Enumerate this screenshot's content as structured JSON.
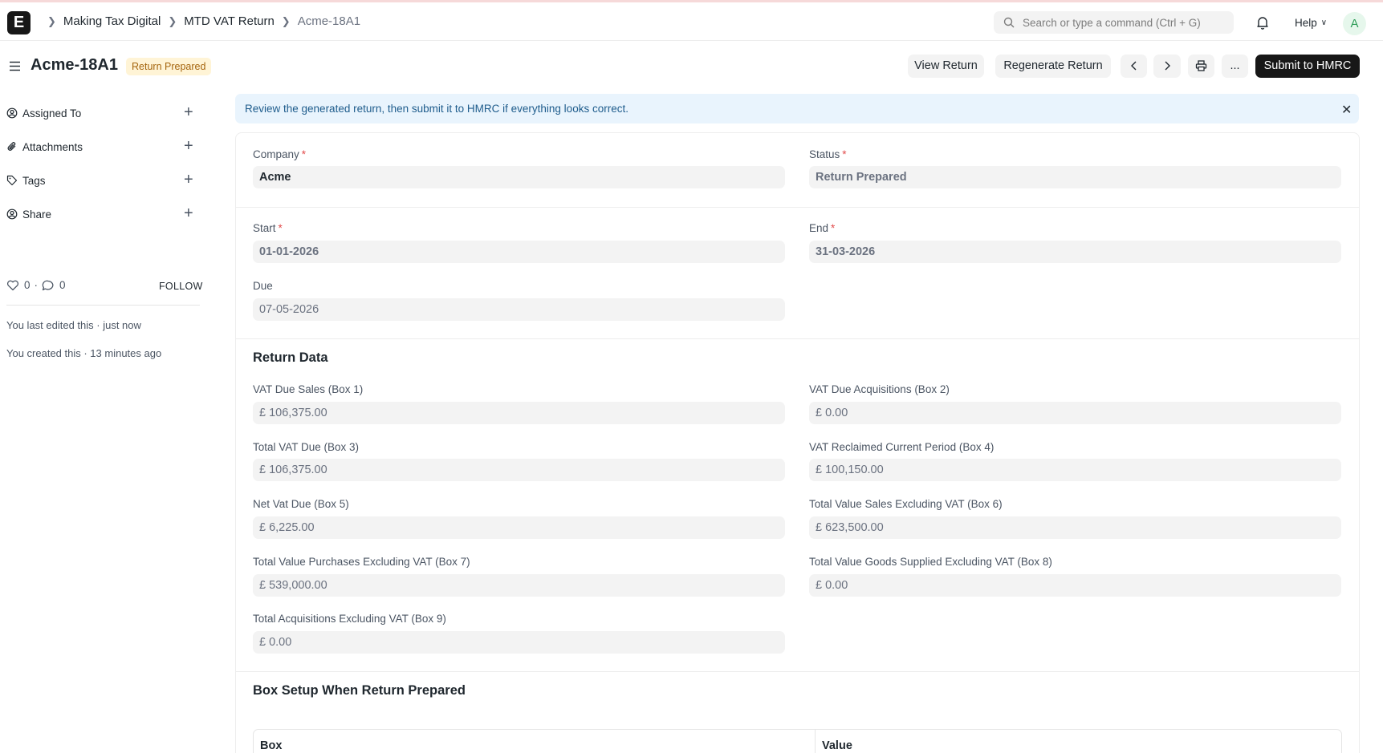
{
  "navbar": {
    "logo_letter": "E",
    "breadcrumbs": [
      "Making Tax Digital",
      "MTD VAT Return",
      "Acme-18A1"
    ],
    "search_placeholder": "Search or type a command (Ctrl + G)",
    "help_label": "Help",
    "avatar_initial": "A"
  },
  "header": {
    "title": "Acme-18A1",
    "status": "Return Prepared",
    "buttons": {
      "view": "View Return",
      "regenerate": "Regenerate Return",
      "more": "...",
      "submit": "Submit to HMRC"
    }
  },
  "sidebar": {
    "items": [
      {
        "label": "Assigned To",
        "icon": "assign-icon"
      },
      {
        "label": "Attachments",
        "icon": "paperclip-icon"
      },
      {
        "label": "Tags",
        "icon": "tag-icon"
      },
      {
        "label": "Share",
        "icon": "share-icon"
      }
    ],
    "likes": "0",
    "comments": "0",
    "follow": "FOLLOW",
    "activity": [
      "You last edited this · just now",
      "You created this · 13 minutes ago"
    ]
  },
  "alert": {
    "message": "Review the generated return, then submit it to HMRC if everything looks correct."
  },
  "form": {
    "company_label": "Company",
    "company": "Acme",
    "status_label": "Status",
    "status": "Return Prepared",
    "start_label": "Start",
    "start": "01-01-2026",
    "end_label": "End",
    "end": "31-03-2026",
    "due_label": "Due",
    "due": "07-05-2026",
    "return_data_title": "Return Data",
    "boxes": {
      "box1_label": "VAT Due Sales (Box 1)",
      "box1": "£ 106,375.00",
      "box2_label": "VAT Due Acquisitions (Box 2)",
      "box2": "£ 0.00",
      "box3_label": "Total VAT Due (Box 3)",
      "box3": "£ 106,375.00",
      "box4_label": "VAT Reclaimed Current Period (Box 4)",
      "box4": "£ 100,150.00",
      "box5_label": "Net Vat Due (Box 5)",
      "box5": "£ 6,225.00",
      "box6_label": "Total Value Sales Excluding VAT (Box 6)",
      "box6": "£ 623,500.00",
      "box7_label": "Total Value Purchases Excluding VAT (Box 7)",
      "box7": "£ 539,000.00",
      "box8_label": "Total Value Goods Supplied Excluding VAT (Box 8)",
      "box8": "£ 0.00",
      "box9_label": "Total Acquisitions Excluding VAT (Box 9)",
      "box9": "£ 0.00"
    },
    "box_setup_title": "Box Setup When Return Prepared",
    "table_headers": [
      "Box",
      "Value"
    ]
  },
  "colors": {
    "primary_button": "#171717",
    "status_pill_bg": "#fff4d6",
    "status_pill_text": "#a5650e",
    "alert_bg": "#e9f4fd",
    "required": "#e24c4c"
  }
}
